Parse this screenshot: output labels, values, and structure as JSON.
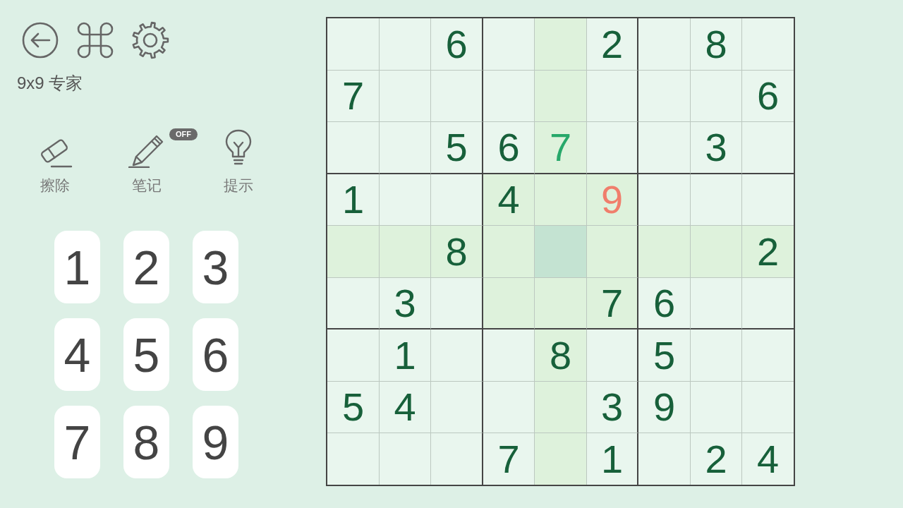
{
  "title": "9x9 专家",
  "tools": [
    {
      "kind": "erase",
      "label": "擦除"
    },
    {
      "kind": "notes",
      "label": "笔记",
      "badge": "OFF"
    },
    {
      "kind": "hint",
      "label": "提示"
    }
  ],
  "keypad": [
    "1",
    "2",
    "3",
    "4",
    "5",
    "6",
    "7",
    "8",
    "9"
  ],
  "board": {
    "rows": [
      [
        {
          "selected": false
        },
        {
          "selected": false
        },
        {
          "value": "6",
          "kind": "given",
          "selected": false
        },
        {
          "selected": false
        },
        {
          "selected": false
        },
        {
          "value": "2",
          "kind": "given",
          "selected": false
        },
        {
          "selected": false
        },
        {
          "value": "8",
          "kind": "given",
          "selected": false
        },
        {
          "selected": false
        }
      ],
      [
        {
          "value": "7",
          "kind": "given",
          "selected": false
        },
        {
          "selected": false
        },
        {
          "selected": false
        },
        {
          "selected": false
        },
        {
          "selected": false
        },
        {
          "selected": false
        },
        {
          "selected": false
        },
        {
          "selected": false
        },
        {
          "value": "6",
          "kind": "given",
          "selected": false
        }
      ],
      [
        {
          "selected": false
        },
        {
          "selected": false
        },
        {
          "value": "5",
          "kind": "given",
          "selected": false
        },
        {
          "value": "6",
          "kind": "given",
          "selected": false
        },
        {
          "value": "7",
          "kind": "entered",
          "selected": false
        },
        {
          "selected": false
        },
        {
          "selected": false
        },
        {
          "value": "3",
          "kind": "given",
          "selected": false
        },
        {
          "selected": false
        }
      ],
      [
        {
          "value": "1",
          "kind": "given",
          "selected": false
        },
        {
          "selected": false
        },
        {
          "selected": false
        },
        {
          "value": "4",
          "kind": "given",
          "selected": false
        },
        {
          "selected": false
        },
        {
          "value": "9",
          "kind": "error",
          "selected": false
        },
        {
          "selected": false
        },
        {
          "selected": false
        },
        {
          "selected": false
        }
      ],
      [
        {
          "selected": false
        },
        {
          "selected": false
        },
        {
          "value": "8",
          "kind": "given",
          "selected": false
        },
        {
          "selected": false
        },
        {
          "selected": true
        },
        {
          "selected": false
        },
        {
          "selected": false
        },
        {
          "selected": false
        },
        {
          "value": "2",
          "kind": "given",
          "selected": false
        }
      ],
      [
        {
          "selected": false
        },
        {
          "value": "3",
          "kind": "given",
          "selected": false
        },
        {
          "selected": false
        },
        {
          "selected": false
        },
        {
          "selected": false
        },
        {
          "value": "7",
          "kind": "given",
          "selected": false
        },
        {
          "value": "6",
          "kind": "given",
          "selected": false
        },
        {
          "selected": false
        },
        {
          "selected": false
        }
      ],
      [
        {
          "selected": false
        },
        {
          "value": "1",
          "kind": "given",
          "selected": false
        },
        {
          "selected": false
        },
        {
          "selected": false
        },
        {
          "value": "8",
          "kind": "given",
          "selected": false
        },
        {
          "selected": false
        },
        {
          "value": "5",
          "kind": "given",
          "selected": false
        },
        {
          "selected": false
        },
        {
          "selected": false
        }
      ],
      [
        {
          "value": "5",
          "kind": "given",
          "selected": false
        },
        {
          "value": "4",
          "kind": "given",
          "selected": false
        },
        {
          "selected": false
        },
        {
          "selected": false
        },
        {
          "selected": false
        },
        {
          "value": "3",
          "kind": "given",
          "selected": false
        },
        {
          "value": "9",
          "kind": "given",
          "selected": false
        },
        {
          "selected": false
        },
        {
          "selected": false
        }
      ],
      [
        {
          "selected": false
        },
        {
          "selected": false
        },
        {
          "selected": false
        },
        {
          "value": "7",
          "kind": "given",
          "selected": false
        },
        {
          "selected": false
        },
        {
          "value": "1",
          "kind": "given",
          "selected": false
        },
        {
          "selected": false
        },
        {
          "value": "2",
          "kind": "given",
          "selected": false
        },
        {
          "value": "4",
          "kind": "given",
          "selected": false
        }
      ]
    ]
  }
}
